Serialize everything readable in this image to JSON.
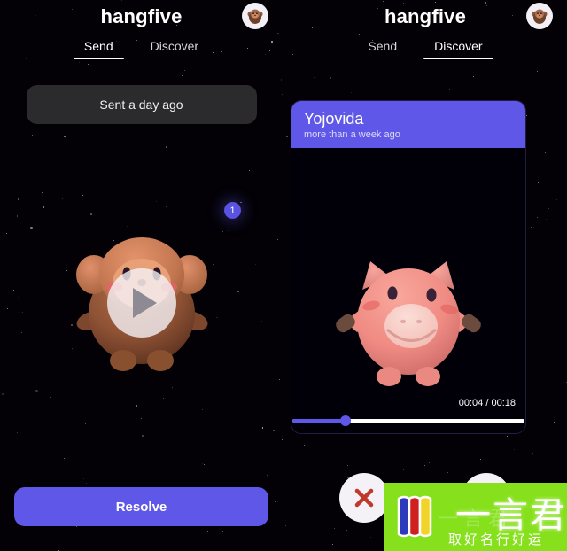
{
  "app": {
    "title": "hangfive",
    "avatar_icon": "monkey-avatar-icon"
  },
  "left_panel": {
    "tabs": [
      {
        "label": "Send",
        "active": true
      },
      {
        "label": "Discover",
        "active": false
      }
    ],
    "status_pill": "Sent a day ago",
    "badge_count": "1",
    "character_icon": "monkey-3d-character",
    "play_icon": "play-icon",
    "primary_button": "Resolve"
  },
  "right_panel": {
    "tabs": [
      {
        "label": "Send",
        "active": false
      },
      {
        "label": "Discover",
        "active": true
      }
    ],
    "card": {
      "title": "Yojovida",
      "subtitle": "more than a week ago",
      "character_icon": "pig-3d-character",
      "time_display": "00:04 / 00:18",
      "current_time": "00:04",
      "duration": "00:18",
      "progress_percent": 23
    },
    "actions": {
      "reject_icon": "close-x-icon",
      "accept_icon": "accept-icon"
    }
  },
  "watermark": {
    "main_text": "一言君",
    "sub_text": "取好名行好运",
    "ghost_text": "一言君",
    "background_color": "#86e01b",
    "book_icon": "book-flag-icon"
  },
  "colors": {
    "accent": "#5f57e8",
    "background": "#030105",
    "pill": "#2b2b2e",
    "reject": "#c0392b"
  }
}
